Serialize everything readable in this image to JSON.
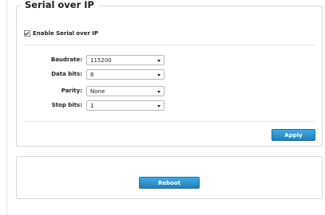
{
  "serial_over_ip": {
    "title": "Serial over IP",
    "enable_label": "Enable Serial over IP",
    "enabled": true,
    "fields": [
      {
        "label": "Baudrate:",
        "value": "115200"
      },
      {
        "label": "Data bits:",
        "value": "8"
      },
      {
        "label": "Parity:",
        "value": "None"
      },
      {
        "label": "Stop bits:",
        "value": "1"
      }
    ],
    "apply_label": "Apply"
  },
  "reboot": {
    "label": "Reboot"
  }
}
